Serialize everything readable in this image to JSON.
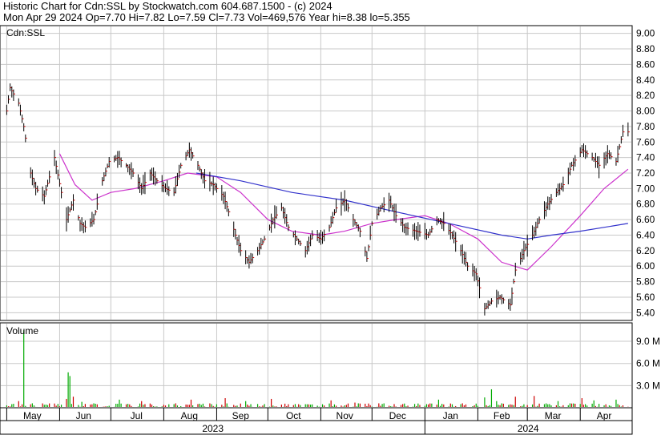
{
  "header": {
    "line1": "Historic Chart for Cdn:SSL by Stockwatch.com 604.687.1500 - (c) 2024",
    "line2": "Mon Apr 29 2024  Op=7.70  Hi=7.82  Lo=7.59  Cl=7.73  Vol=469,576  Year hi=8.38  lo=5.355"
  },
  "chart_data": [
    {
      "type": "ohlc",
      "title": "Cdn:SSL",
      "ylim": [
        5.3,
        9.1
      ],
      "yticks": [
        "9.00",
        "8.80",
        "8.60",
        "8.40",
        "8.20",
        "8.00",
        "7.80",
        "7.60",
        "7.40",
        "7.20",
        "7.00",
        "6.80",
        "6.60",
        "6.40",
        "6.20",
        "6.00",
        "5.80",
        "5.60",
        "5.40"
      ],
      "x_months": [
        "May",
        "Jun",
        "Jul",
        "Aug",
        "Sep",
        "Oct",
        "Nov",
        "Dec",
        "Jan",
        "Feb",
        "Mar",
        "Apr"
      ],
      "x_years": [
        "2023",
        "2024"
      ],
      "grid": true,
      "colors": {
        "bar": "#000000",
        "tick_right": "#cc0000",
        "ma_short": "#cc33cc",
        "ma_long": "#3333cc",
        "grid": "#c8c8c8"
      },
      "close_points": [
        [
          "2023-05-01",
          8.0
        ],
        [
          "2023-05-03",
          8.3
        ],
        [
          "2023-05-08",
          8.1
        ],
        [
          "2023-05-11",
          7.8
        ],
        [
          "2023-05-15",
          7.2
        ],
        [
          "2023-05-18",
          7.0
        ],
        [
          "2023-05-23",
          6.9
        ],
        [
          "2023-05-29",
          7.4
        ],
        [
          "2023-06-02",
          6.95
        ],
        [
          "2023-06-05",
          6.6
        ],
        [
          "2023-06-09",
          6.85
        ],
        [
          "2023-06-13",
          6.55
        ],
        [
          "2023-06-16",
          6.5
        ],
        [
          "2023-06-21",
          6.6
        ],
        [
          "2023-06-26",
          7.1
        ],
        [
          "2023-06-30",
          7.35
        ],
        [
          "2023-07-05",
          7.4
        ],
        [
          "2023-07-10",
          7.3
        ],
        [
          "2023-07-14",
          7.2
        ],
        [
          "2023-07-19",
          7.0
        ],
        [
          "2023-07-24",
          7.2
        ],
        [
          "2023-07-28",
          7.1
        ],
        [
          "2023-08-02",
          7.0
        ],
        [
          "2023-08-07",
          6.95
        ],
        [
          "2023-08-11",
          7.3
        ],
        [
          "2023-08-16",
          7.5
        ],
        [
          "2023-08-21",
          7.3
        ],
        [
          "2023-08-25",
          7.1
        ],
        [
          "2023-08-30",
          7.05
        ],
        [
          "2023-09-05",
          6.9
        ],
        [
          "2023-09-08",
          6.7
        ],
        [
          "2023-09-12",
          6.4
        ],
        [
          "2023-09-15",
          6.2
        ],
        [
          "2023-09-20",
          6.05
        ],
        [
          "2023-09-25",
          6.2
        ],
        [
          "2023-09-29",
          6.35
        ],
        [
          "2023-10-04",
          6.6
        ],
        [
          "2023-10-09",
          6.75
        ],
        [
          "2023-10-13",
          6.5
        ],
        [
          "2023-10-18",
          6.35
        ],
        [
          "2023-10-23",
          6.2
        ],
        [
          "2023-10-27",
          6.4
        ],
        [
          "2023-11-01",
          6.35
        ],
        [
          "2023-11-06",
          6.5
        ],
        [
          "2023-11-10",
          6.75
        ],
        [
          "2023-11-15",
          6.85
        ],
        [
          "2023-11-20",
          6.6
        ],
        [
          "2023-11-24",
          6.45
        ],
        [
          "2023-11-28",
          6.1
        ],
        [
          "2023-12-01",
          6.55
        ],
        [
          "2023-12-06",
          6.75
        ],
        [
          "2023-12-11",
          6.85
        ],
        [
          "2023-12-15",
          6.65
        ],
        [
          "2023-12-20",
          6.5
        ],
        [
          "2023-12-27",
          6.45
        ],
        [
          "2024-01-03",
          6.4
        ],
        [
          "2024-01-08",
          6.6
        ],
        [
          "2024-01-12",
          6.55
        ],
        [
          "2024-01-17",
          6.4
        ],
        [
          "2024-01-22",
          6.2
        ],
        [
          "2024-01-26",
          6.0
        ],
        [
          "2024-01-31",
          5.9
        ],
        [
          "2024-02-05",
          5.45
        ],
        [
          "2024-02-09",
          5.55
        ],
        [
          "2024-02-14",
          5.6
        ],
        [
          "2024-02-20",
          5.5
        ],
        [
          "2024-02-23",
          5.95
        ],
        [
          "2024-02-28",
          6.2
        ],
        [
          "2024-03-04",
          6.4
        ],
        [
          "2024-03-08",
          6.6
        ],
        [
          "2024-03-13",
          6.8
        ],
        [
          "2024-03-18",
          6.95
        ],
        [
          "2024-03-22",
          7.05
        ],
        [
          "2024-03-27",
          7.3
        ],
        [
          "2024-04-02",
          7.5
        ],
        [
          "2024-04-08",
          7.4
        ],
        [
          "2024-04-12",
          7.3
        ],
        [
          "2024-04-17",
          7.45
        ],
        [
          "2024-04-22",
          7.35
        ],
        [
          "2024-04-26",
          7.73
        ]
      ],
      "ma_short": [
        [
          "2023-06-01",
          7.45
        ],
        [
          "2023-06-10",
          7.05
        ],
        [
          "2023-06-20",
          6.85
        ],
        [
          "2023-07-01",
          6.95
        ],
        [
          "2023-07-15",
          7.0
        ],
        [
          "2023-08-01",
          7.1
        ],
        [
          "2023-08-15",
          7.2
        ],
        [
          "2023-09-01",
          7.15
        ],
        [
          "2023-09-15",
          6.95
        ],
        [
          "2023-10-01",
          6.6
        ],
        [
          "2023-10-15",
          6.45
        ],
        [
          "2023-11-01",
          6.4
        ],
        [
          "2023-11-15",
          6.45
        ],
        [
          "2023-12-01",
          6.55
        ],
        [
          "2023-12-15",
          6.6
        ],
        [
          "2024-01-01",
          6.65
        ],
        [
          "2024-01-15",
          6.55
        ],
        [
          "2024-02-01",
          6.35
        ],
        [
          "2024-02-15",
          6.05
        ],
        [
          "2024-03-01",
          5.95
        ],
        [
          "2024-03-15",
          6.25
        ],
        [
          "2024-04-01",
          6.65
        ],
        [
          "2024-04-15",
          7.0
        ],
        [
          "2024-04-29",
          7.25
        ]
      ],
      "ma_long": [
        [
          "2023-08-20",
          7.2
        ],
        [
          "2023-09-15",
          7.1
        ],
        [
          "2023-10-15",
          6.95
        ],
        [
          "2023-11-15",
          6.85
        ],
        [
          "2023-12-15",
          6.7
        ],
        [
          "2024-01-15",
          6.55
        ],
        [
          "2024-02-15",
          6.4
        ],
        [
          "2024-03-01",
          6.35
        ],
        [
          "2024-03-15",
          6.4
        ],
        [
          "2024-04-01",
          6.45
        ],
        [
          "2024-04-29",
          6.55
        ]
      ]
    },
    {
      "type": "bar",
      "title": "Volume",
      "yticks": [
        "9.0 M",
        "6.0 M",
        "3.0 M"
      ],
      "ylim": [
        0,
        11.5
      ],
      "values": [
        [
          "2023-05-08",
          0.9
        ],
        [
          "2023-05-11",
          10.5
        ],
        [
          "2023-05-16",
          0.6
        ],
        [
          "2023-05-23",
          0.4
        ],
        [
          "2023-06-05",
          1.2
        ],
        [
          "2023-06-06",
          4.8
        ],
        [
          "2023-06-07",
          4.3
        ],
        [
          "2023-06-09",
          1.5
        ],
        [
          "2023-06-14",
          0.8
        ],
        [
          "2023-06-21",
          0.6
        ],
        [
          "2023-07-06",
          1.1
        ],
        [
          "2023-07-19",
          0.9
        ],
        [
          "2023-08-08",
          0.6
        ],
        [
          "2023-08-17",
          1.1
        ],
        [
          "2023-09-06",
          1.3
        ],
        [
          "2023-09-18",
          0.9
        ],
        [
          "2023-10-03",
          1.2
        ],
        [
          "2023-10-17",
          0.5
        ],
        [
          "2023-11-07",
          1.0
        ],
        [
          "2023-11-21",
          0.7
        ],
        [
          "2023-12-05",
          0.6
        ],
        [
          "2023-12-19",
          0.5
        ],
        [
          "2024-01-09",
          1.1
        ],
        [
          "2024-01-23",
          0.6
        ],
        [
          "2024-02-05",
          1.4
        ],
        [
          "2024-02-09",
          2.5
        ],
        [
          "2024-02-12",
          0.9
        ],
        [
          "2024-02-15",
          0.6
        ],
        [
          "2024-02-23",
          1.5
        ],
        [
          "2024-03-05",
          1.6
        ],
        [
          "2024-03-19",
          0.9
        ],
        [
          "2024-04-02",
          1.3
        ],
        [
          "2024-04-09",
          1.0
        ],
        [
          "2024-04-22",
          1.1
        ]
      ]
    }
  ]
}
